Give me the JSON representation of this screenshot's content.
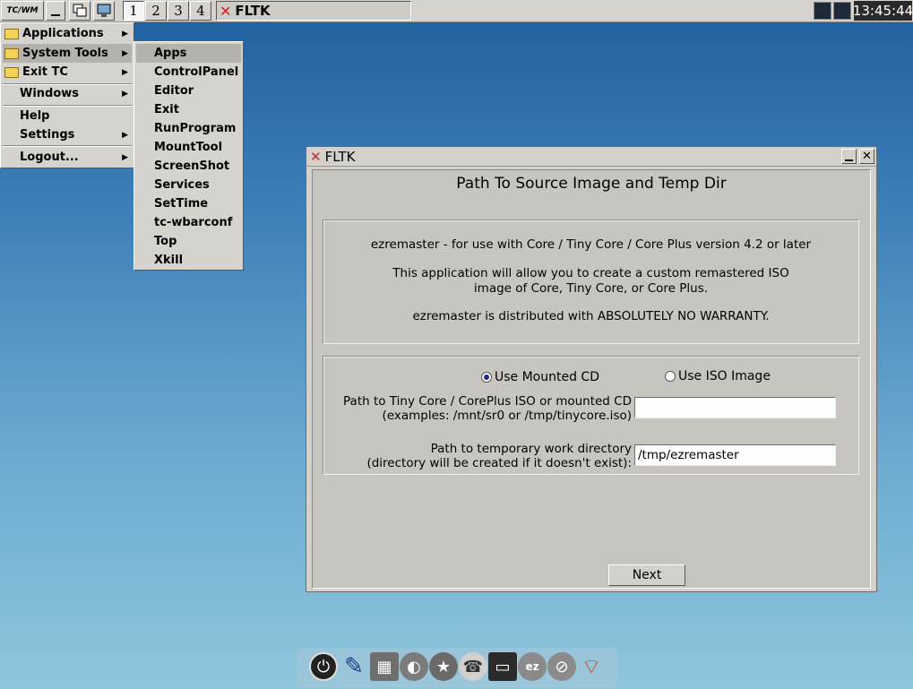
{
  "taskbar": {
    "logo_label": "TC/WM",
    "workspaces": [
      "1",
      "2",
      "3",
      "4"
    ],
    "active_window_title": "FLTK",
    "clock": "13:45:44"
  },
  "main_menu": {
    "items": [
      {
        "label": "Applications",
        "folder": true,
        "submenu": true
      },
      {
        "label": "System Tools",
        "folder": true,
        "submenu": true
      },
      {
        "label": "Exit TC",
        "folder": true,
        "submenu": true
      },
      {
        "label": "Windows",
        "submenu": true
      },
      {
        "label": "Help"
      },
      {
        "label": "Settings",
        "submenu": true
      },
      {
        "label": "Logout...",
        "submenu": true
      }
    ]
  },
  "system_tools_menu": {
    "items": [
      "Apps",
      "ControlPanel",
      "Editor",
      "Exit",
      "RunProgram",
      "MountTool",
      "ScreenShot",
      "Services",
      "SetTime",
      "tc-wbarconf",
      "Top",
      "Xkill"
    ]
  },
  "dialog": {
    "title": "FLTK",
    "heading": "Path To Source Image and Temp Dir",
    "info_line1": "ezremaster - for use with Core / Tiny Core / Core Plus version 4.2 or later",
    "info_line2": "This application will allow you to create a custom remastered ISO",
    "info_line3": "image of Core, Tiny Core, or Core Plus.",
    "info_line4": "ezremaster is distributed with ABSOLUTELY NO WARRANTY.",
    "radio_mounted": "Use Mounted CD",
    "radio_iso": "Use ISO Image",
    "iso_label_line1": "Path to Tiny Core / CorePlus ISO or mounted CD",
    "iso_label_line2": "(examples:  /mnt/sr0 or  /tmp/tinycore.iso)",
    "iso_value": "",
    "temp_label_line1": "Path to temporary work directory",
    "temp_label_line2": "(directory will be created if it doesn't exist):",
    "temp_value": "/tmp/ezremaster",
    "next_button": "Next"
  },
  "colors": {
    "accent_x": "#d42020",
    "selected_radio": "#1d2b8a",
    "menu_highlight": "#b5b2ad"
  },
  "dock_icons": [
    "power-icon",
    "paint-brush-icon",
    "calculator-icon",
    "disk-icon",
    "runner-icon",
    "phone-icon",
    "terminal-icon",
    "ezremaster-icon",
    "apps-icon",
    "wifi-icon"
  ]
}
